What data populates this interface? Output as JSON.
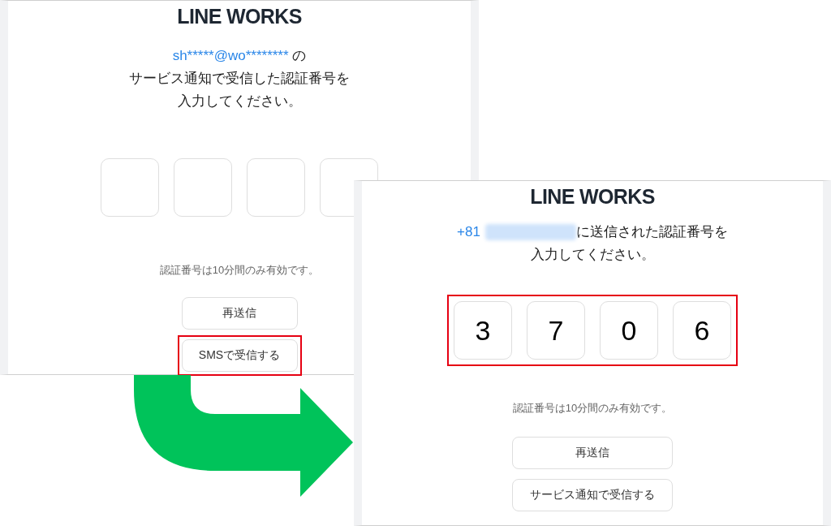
{
  "screens": [
    {
      "logo": "LINE WORKS",
      "recipient": "sh*****@wo********",
      "recipient_suffix": " の",
      "masked_number": false,
      "message_lines": [
        "サービス通知で受信した認証番号を",
        "入力してください。"
      ],
      "code_highlighted": false,
      "code_fields": [
        {
          "kind": "empty"
        },
        {
          "kind": "empty"
        },
        {
          "kind": "empty"
        },
        {
          "kind": "empty"
        }
      ],
      "note": "認証番号は10分間のみ有効です。",
      "buttons": [
        {
          "label": "再送信",
          "highlighted": false
        },
        {
          "label": "SMSで受信する",
          "highlighted": true
        }
      ]
    },
    {
      "logo": "LINE WORKS",
      "recipient": "+81",
      "recipient_suffix": "に送信された認証番号を",
      "masked_number": true,
      "message_lines": [
        "入力してください。"
      ],
      "code_highlighted": true,
      "code_fields": [
        {
          "kind": "filled",
          "value": "3"
        },
        {
          "kind": "filled",
          "value": "7"
        },
        {
          "kind": "filled",
          "value": "0"
        },
        {
          "kind": "filled",
          "value": "6"
        }
      ],
      "note": "認証番号は10分間のみ有効です。",
      "buttons": [
        {
          "label": "再送信",
          "highlighted": false
        },
        {
          "label": "サービス通知で受信する",
          "highlighted": false
        }
      ]
    }
  ]
}
